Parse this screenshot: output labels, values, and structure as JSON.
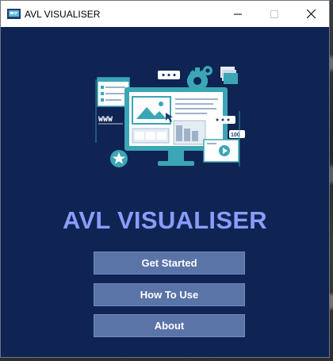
{
  "window": {
    "title": "AVL VISUALISER"
  },
  "main": {
    "heading": "AVL VISUALISER",
    "illustration_text": "WWW",
    "buttons": [
      {
        "label": "Get Started"
      },
      {
        "label": "How To Use"
      },
      {
        "label": "About"
      }
    ]
  },
  "icons": [
    "app-icon",
    "minimize-icon",
    "maximize-icon",
    "close-icon",
    "website-illustration"
  ],
  "colors": {
    "background": "#0f2452",
    "heading": "#8a9cff",
    "button": "#5a74a8",
    "illustration_accent": "#3aa6b6"
  }
}
